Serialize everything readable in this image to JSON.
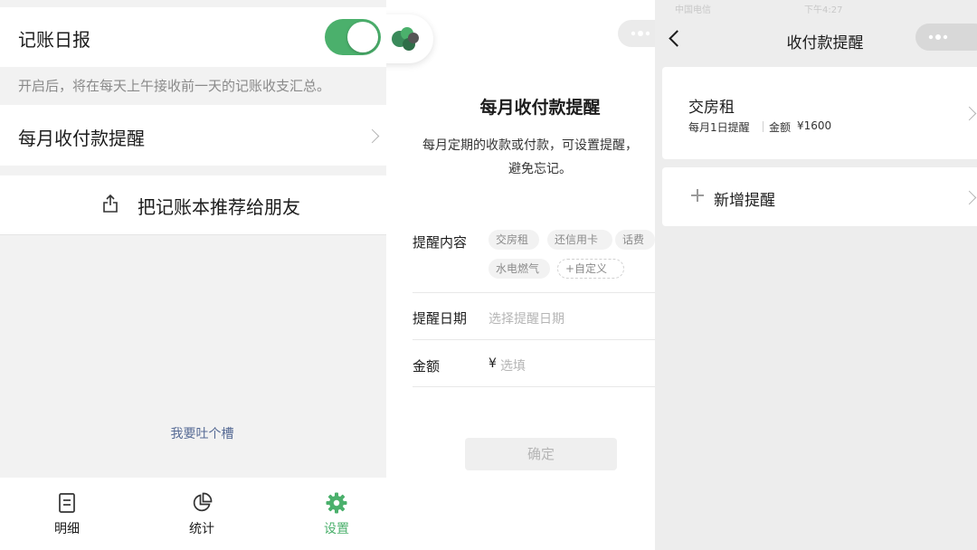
{
  "settings_screen": {
    "daily_report": {
      "label": "记账日报",
      "enabled": true
    },
    "daily_note": "开启后，将在每天上午接收前一天的记账收支汇总。",
    "monthly_reminder_label": "每月收付款提醒",
    "recommend_label": "把记账本推荐给朋友",
    "feedback_link": "我要吐个槽",
    "tabs": [
      {
        "label": "明细",
        "icon": "list-icon",
        "active": false
      },
      {
        "label": "统计",
        "icon": "pie-chart-icon",
        "active": false
      },
      {
        "label": "设置",
        "icon": "gear-icon",
        "active": true
      }
    ],
    "accent_color": "#4bb06c"
  },
  "reminder_form": {
    "title": "每月收付款提醒",
    "description_line1": "每月定期的收款或付款，可设置提醒，",
    "description_line2": "避免忘记。",
    "content_label": "提醒内容",
    "content_chips": [
      "交房租",
      "还信用卡",
      "话费",
      "水电燃气"
    ],
    "custom_chip": "+自定义",
    "date_label": "提醒日期",
    "date_placeholder": "选择提醒日期",
    "amount_label": "金额",
    "currency_symbol": "¥",
    "amount_placeholder": "选填",
    "confirm_label": "确定"
  },
  "reminder_list": {
    "status_carrier": "中国电信",
    "status_time": "下午4:27",
    "title": "收付款提醒",
    "items": [
      {
        "title": "交房租",
        "date_text": "每月1日提醒",
        "amount_label": "金额",
        "amount": "¥1600"
      }
    ],
    "add_label": "新增提醒"
  }
}
